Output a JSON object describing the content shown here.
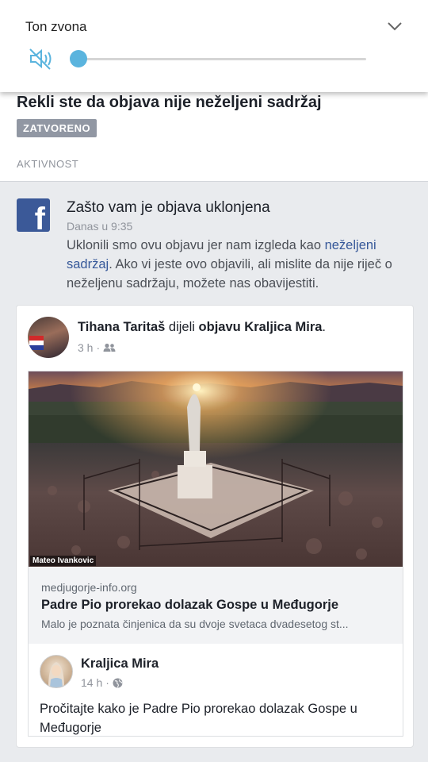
{
  "volume_panel": {
    "title": "Ton zvona",
    "level": 0
  },
  "report": {
    "title": "Rekli ste da objava nije neželjeni sadržaj",
    "status_badge": "ZATVORENO",
    "section_label": "AKTIVNOST"
  },
  "notice": {
    "title": "Zašto vam je objava uklonjena",
    "time": "Danas u 9:35",
    "body_part1": "Uklonili smo ovu objavu jer nam izgleda kao ",
    "body_link": "neželjeni sadržaj",
    "body_part2": ". Ako vi jeste ovo objavili, ali mislite da nije riječ o neželjenu sadržaju, možete nas obavijestiti."
  },
  "post": {
    "author": "Tihana Taritaš",
    "action": " dijeli ",
    "target": "objavu Kraljica Mira",
    "suffix": ".",
    "time": "3 h",
    "dot": "·",
    "photo_credit": "Mateo Ivankovic",
    "link_domain": "medjugorje-info.org",
    "link_title": "Padre Pio prorekao dolazak Gospe u Međugorje",
    "link_description": "Malo je poznata činjenica da su dvoje svetaca dvadesetog st..."
  },
  "inner_post": {
    "page_name": "Kraljica Mira",
    "time": "14 h",
    "dot": "·",
    "text": "Pročitajte kako je Padre Pio prorekao dolazak Gospe u Međugorje"
  },
  "icons": {
    "mute": "speaker-muted-icon",
    "chevron": "chevron-down-icon",
    "facebook": "facebook-logo",
    "friends": "friends-icon",
    "globe": "globe-icon"
  },
  "colors": {
    "accent": "#5ab4de",
    "facebook_blue": "#3b5998",
    "link_blue": "#365899",
    "badge_gray": "#9197a3"
  }
}
